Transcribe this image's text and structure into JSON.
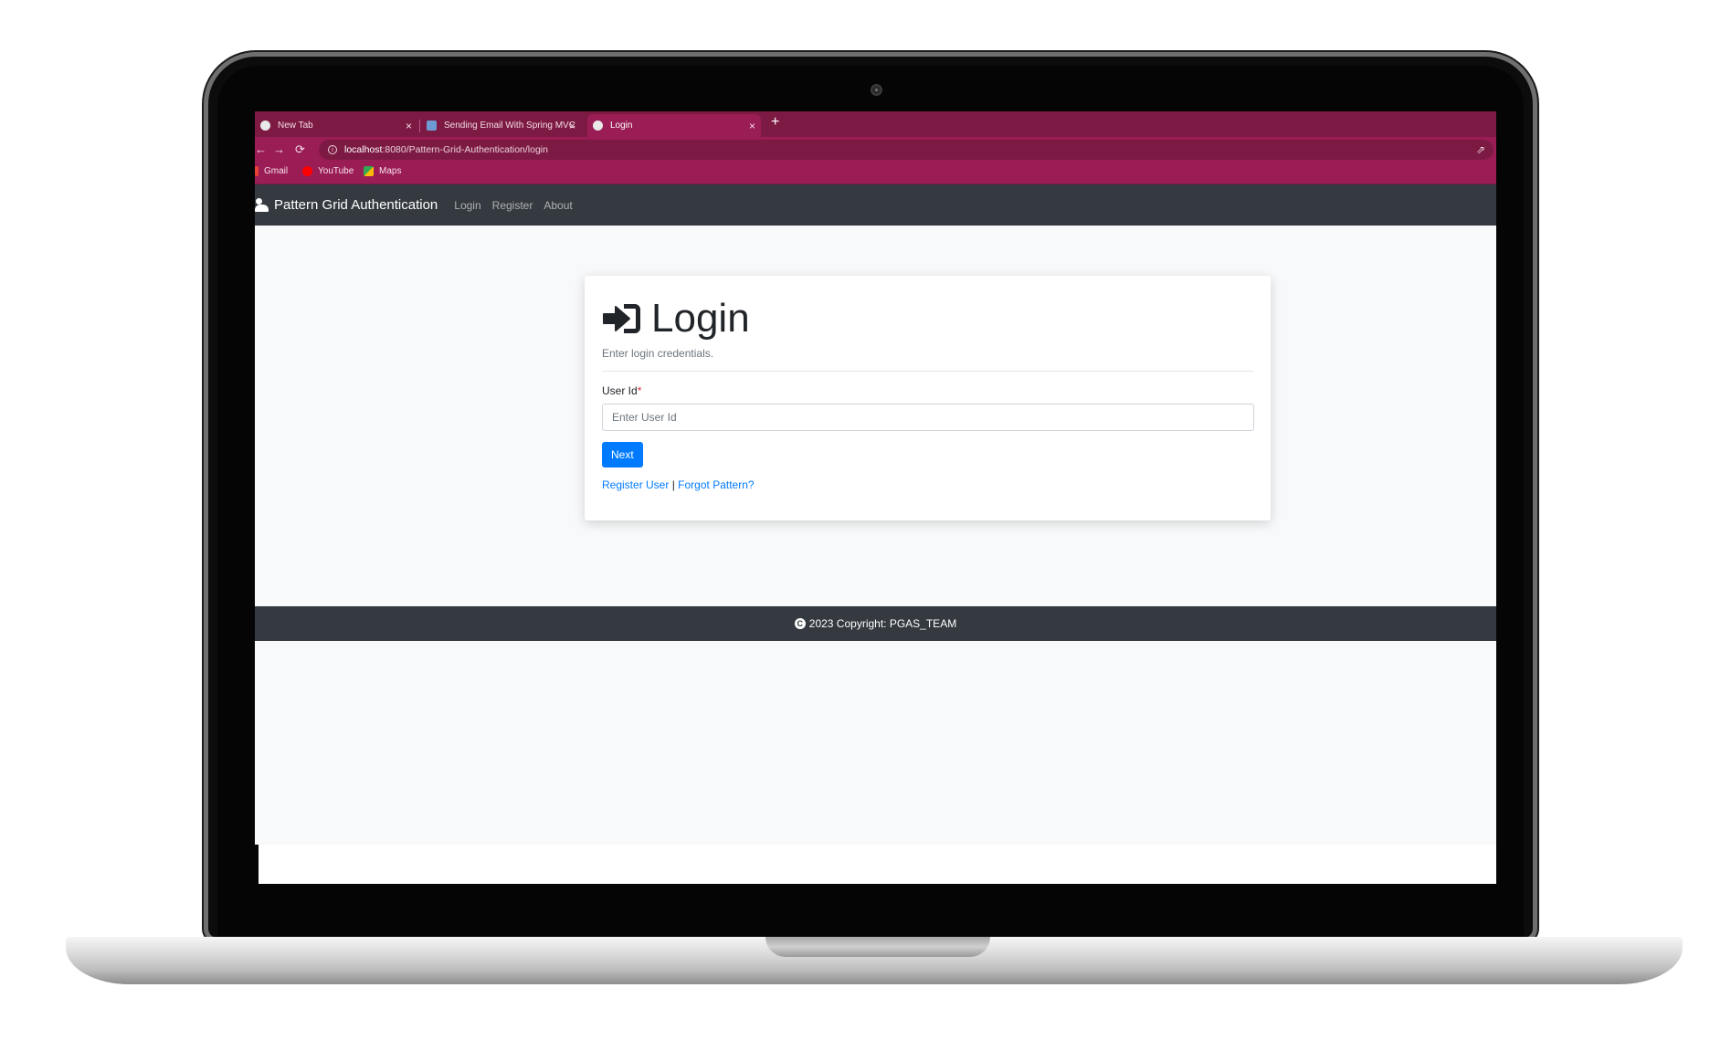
{
  "browser": {
    "tabs": [
      {
        "title": "New Tab",
        "icon": "chrome-icon",
        "active": false
      },
      {
        "title": "Sending Email With Spring MVC",
        "icon": "spring-icon",
        "active": false
      },
      {
        "title": "Login",
        "icon": "globe-icon",
        "active": true
      }
    ],
    "new_tab_symbol": "+",
    "close_symbol": "×",
    "address": {
      "host": "localhost",
      "path": ":8080/Pattern-Grid-Authentication/login"
    },
    "bookmarks": [
      {
        "label": "Gmail",
        "icon": "gmail-icon",
        "color": "#ea4335"
      },
      {
        "label": "YouTube",
        "icon": "youtube-icon",
        "color": "#ff0000"
      },
      {
        "label": "Maps",
        "icon": "maps-icon",
        "color": "#34a853"
      }
    ],
    "theme_color": "#9a1d55"
  },
  "navbar": {
    "brand": "Pattern Grid Authentication",
    "links": [
      "Login",
      "Register",
      "About"
    ]
  },
  "login": {
    "title": "Login",
    "subtitle": "Enter login credentials.",
    "user_id_label": "User Id",
    "required_mark": "*",
    "user_id_placeholder": "Enter User Id",
    "user_id_value": "",
    "next_button": "Next",
    "register_link": "Register User",
    "separator": "|",
    "forgot_link": "Forgot Pattern?"
  },
  "footer": {
    "text": "2023 Copyright: PGAS_TEAM"
  },
  "colors": {
    "navbar": "#343a40",
    "primary": "#007bff",
    "page_bg": "#f8f9fa"
  }
}
